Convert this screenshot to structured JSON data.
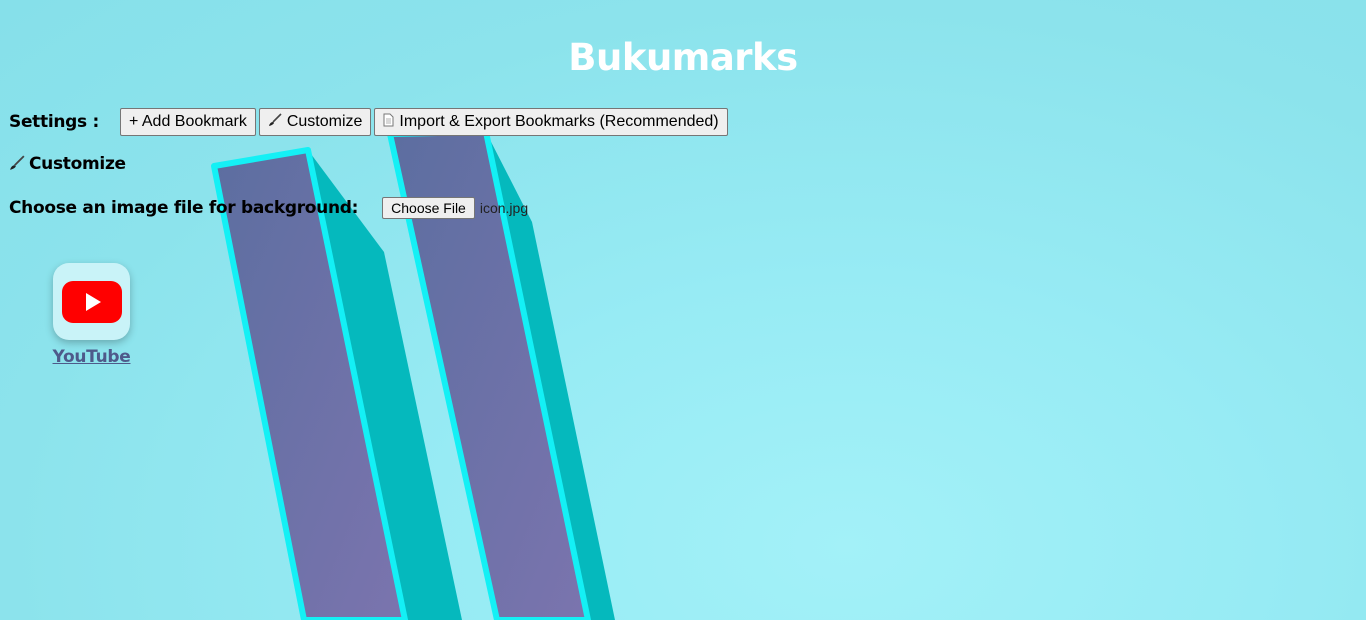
{
  "page": {
    "title": "Bukumarks"
  },
  "settings": {
    "label": "Settings :",
    "buttons": [
      {
        "icon": "plus",
        "label": "+ Add Bookmark"
      },
      {
        "icon": "brush-icon",
        "label": "Customize"
      },
      {
        "icon": "document-icon",
        "label": "Import & Export Bookmarks (Recommended)"
      }
    ]
  },
  "customize": {
    "heading": "Customize",
    "icon": "brush-icon",
    "background_label": "Choose an image file for background:",
    "file_button": "Choose File",
    "file_name": "icon.jpg"
  },
  "bookmarks": [
    {
      "label": "YouTube",
      "icon": "youtube-icon"
    }
  ],
  "colors": {
    "background": "#8ce3ec",
    "title": "#ffffff",
    "bookmark_label": "#4e5a8a",
    "youtube_red": "#ff0000",
    "art_face": "#6a70a6",
    "art_side": "#05bcbf",
    "art_edge": "#14f0f5"
  }
}
